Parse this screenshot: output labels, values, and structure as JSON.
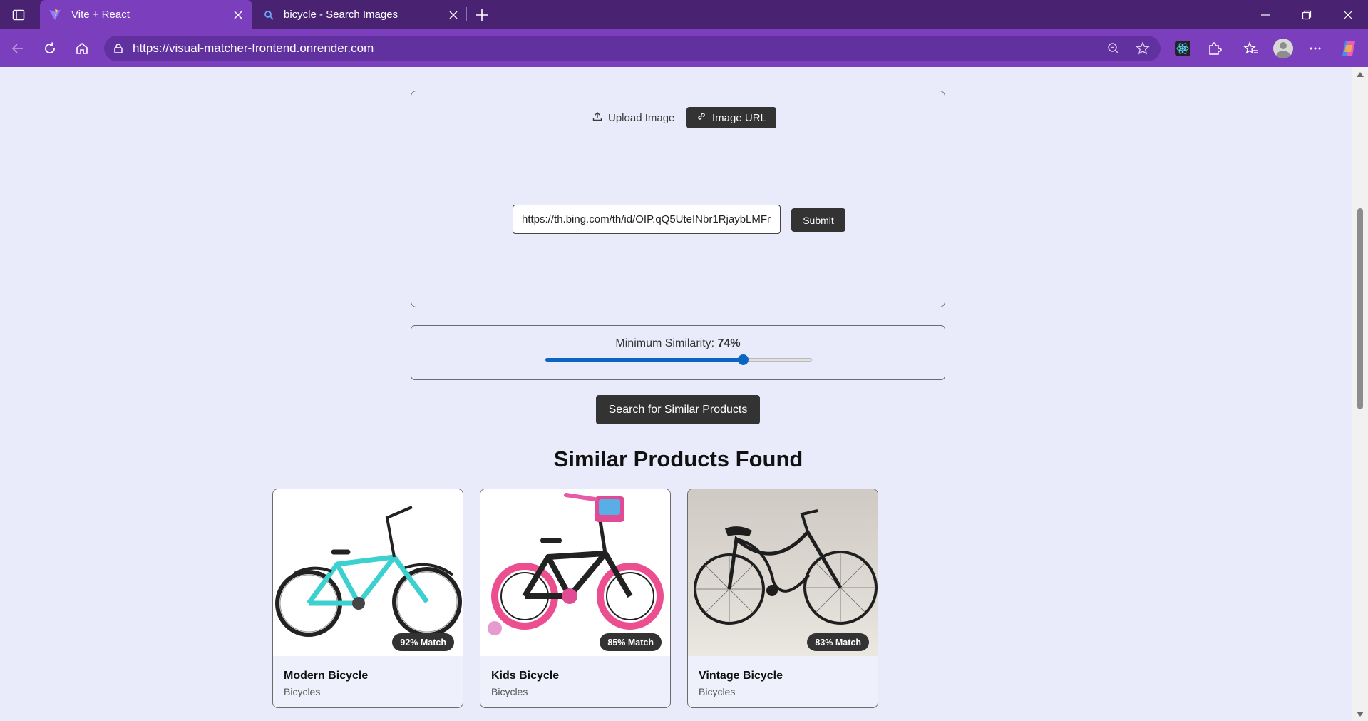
{
  "browser": {
    "tabs": [
      {
        "title": "Vite + React",
        "active": true,
        "favicon": "vite-icon"
      },
      {
        "title": "bicycle - Search Images",
        "active": false,
        "favicon": "search-icon"
      }
    ],
    "url": "https://visual-matcher-frontend.onrender.com",
    "theme": {
      "tabbar": "#4a2272",
      "toolbar": "#7b3fbe"
    }
  },
  "upload": {
    "upload_label": "Upload Image",
    "url_label": "Image URL",
    "active_mode": "Image URL",
    "url_value": "https://th.bing.com/th/id/OIP.qQ5UteINbr1RjaybLMFr",
    "submit_label": "Submit"
  },
  "similarity": {
    "label": "Minimum Similarity:",
    "value_text": "74%",
    "value": 74
  },
  "search_button": "Search for Similar Products",
  "results": {
    "title": "Similar Products Found",
    "items": [
      {
        "name": "Modern Bicycle",
        "category": "Bicycles",
        "match": "92% Match"
      },
      {
        "name": "Kids Bicycle",
        "category": "Bicycles",
        "match": "85% Match"
      },
      {
        "name": "Vintage Bicycle",
        "category": "Bicycles",
        "match": "83% Match"
      }
    ]
  },
  "colors": {
    "accent": "#0a66c2",
    "dark_button": "#333333",
    "page_bg": "#e9ebfb"
  }
}
